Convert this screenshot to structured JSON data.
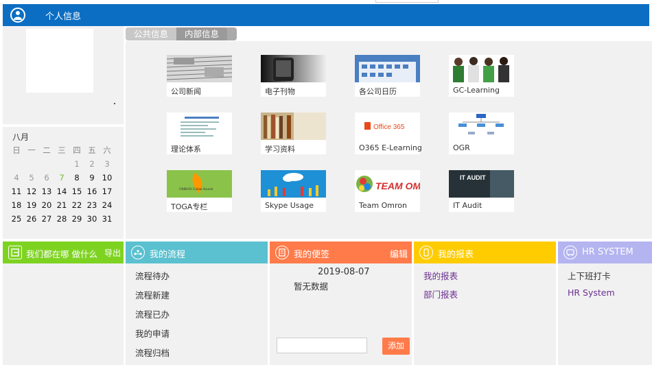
{
  "header": {
    "title": "个人信息"
  },
  "calendar": {
    "month": "八月",
    "weekdays": [
      "日",
      "一",
      "二",
      "三",
      "四",
      "五",
      "六"
    ],
    "weeks": [
      [
        "",
        "",
        "",
        "",
        "1",
        "2",
        "3"
      ],
      [
        "4",
        "5",
        "6",
        "7",
        "8",
        "9",
        "10"
      ],
      [
        "11",
        "12",
        "13",
        "14",
        "15",
        "16",
        "17"
      ],
      [
        "18",
        "19",
        "20",
        "21",
        "22",
        "23",
        "24"
      ],
      [
        "25",
        "26",
        "27",
        "28",
        "29",
        "30",
        "31"
      ]
    ],
    "today": "7"
  },
  "tabs": {
    "public": "公共信息",
    "internal": "内部信息"
  },
  "tiles": [
    {
      "label": "公司新闻",
      "icon": "newspaper-image"
    },
    {
      "label": "电子刊物",
      "icon": "phone-image"
    },
    {
      "label": "各公司日历",
      "icon": "calendar-image"
    },
    {
      "label": "GC-Learning",
      "icon": "people-image"
    },
    {
      "label": "理论体系",
      "icon": "document-image"
    },
    {
      "label": "学习资料",
      "icon": "bookshelf-image"
    },
    {
      "label": "O365 E-Learning",
      "icon": "office365-logo",
      "logo_text": "Office 365"
    },
    {
      "label": "OGR",
      "icon": "org-chart-image"
    },
    {
      "label": "TOGA专栏",
      "icon": "toga-award-image",
      "logo_text": "OMRON Global Awards"
    },
    {
      "label": "Skype Usage",
      "icon": "cloud-image"
    },
    {
      "label": "Team Omron",
      "icon": "team-omron-logo",
      "logo_text": "TEAM OMRON"
    },
    {
      "label": "IT Audit",
      "icon": "it-audit-image",
      "logo_text": "IT AUDIT"
    }
  ],
  "widgets": {
    "where": {
      "title": "我们都在哪 做什么",
      "action": "导出",
      "color": "#7ed321"
    },
    "process": {
      "title": "我的流程",
      "color": "#5bc0cf",
      "items": [
        "流程待办",
        "流程新建",
        "流程已办",
        "我的申请",
        "流程归档"
      ]
    },
    "notes": {
      "title": "我的便签",
      "action": "编辑",
      "color": "#ff7b4a",
      "date": "2019-08-07",
      "empty": "暂无数据",
      "add_label": "添加"
    },
    "reports": {
      "title": "我的报表",
      "color": "#ffcc00",
      "items": [
        "我的报表",
        "部门报表"
      ]
    },
    "hr": {
      "title": "HR SYSTEM",
      "color": "#b4b4f0",
      "items": [
        "上下班打卡",
        "HR System"
      ]
    }
  },
  "colors": {
    "header": "#0c6ec3",
    "link": "#6a2f8f"
  }
}
